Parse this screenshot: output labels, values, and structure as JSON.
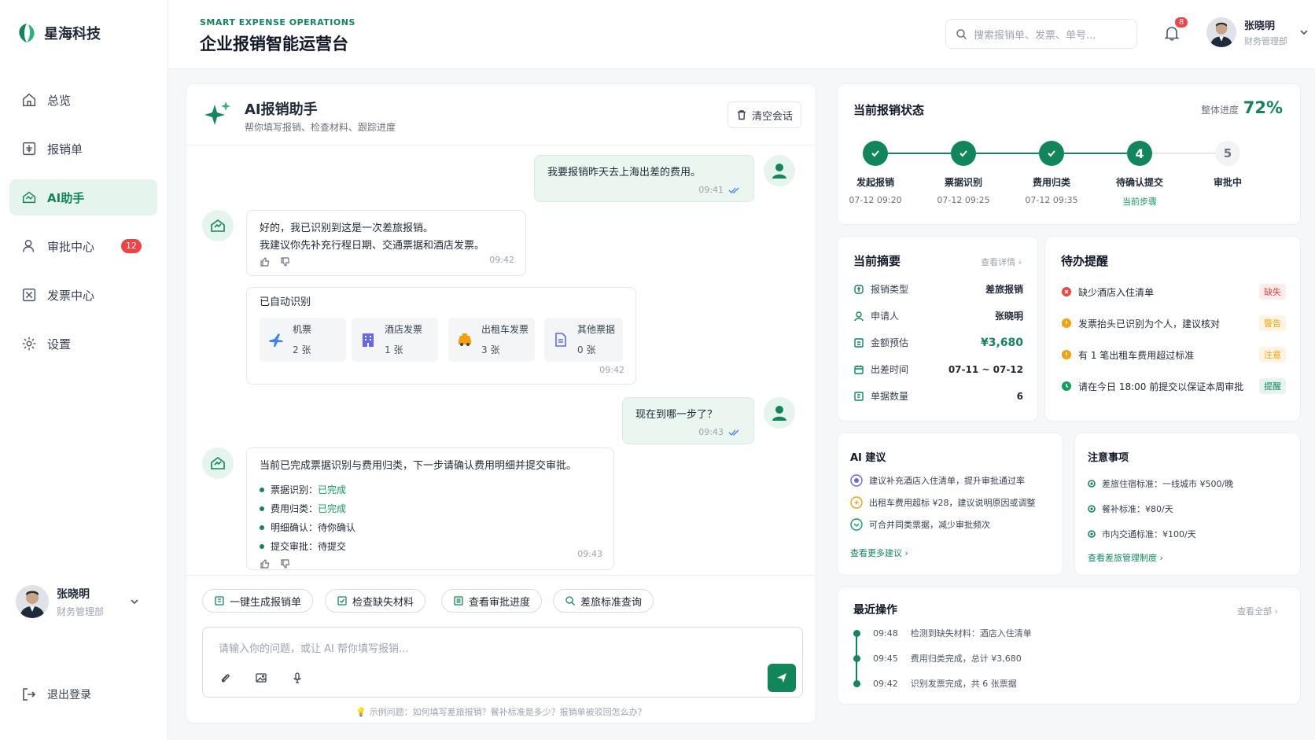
{
  "brand": {
    "name": "星海科技"
  },
  "nav": {
    "items": [
      {
        "label": "总览"
      },
      {
        "label": "报销单"
      },
      {
        "label": "AI助手"
      },
      {
        "label": "审批中心",
        "badge": "12"
      },
      {
        "label": "发票中心"
      },
      {
        "label": "设置"
      }
    ]
  },
  "user": {
    "name": "张晓明",
    "role": "财务管理部"
  },
  "logout": "退出登录",
  "header": {
    "subtitle": "SMART EXPENSE OPERATIONS",
    "title": "企业报销智能运营台",
    "search_placeholder": "搜索报销单、发票、单号...",
    "notification_count": "8"
  },
  "chat": {
    "title": "AI报销助手",
    "subtitle": "帮你填写报销、检查材料、跟踪进度",
    "clear_label": "清空会话",
    "msg1": {
      "text": "我要报销昨天去上海出差的费用。",
      "time": "09:41"
    },
    "msg2": {
      "line1": "好的，我已识别到这是一次差旅报销。",
      "line2": "我建议你先补充行程日期、交通票据和酒店发票。",
      "time": "09:42"
    },
    "recognized": {
      "title": "已自动识别",
      "items": [
        {
          "name": "机票",
          "count": "2 张"
        },
        {
          "name": "酒店发票",
          "count": "1 张"
        },
        {
          "name": "出租车发票",
          "count": "3 张"
        },
        {
          "name": "其他票据",
          "count": "0 张"
        }
      ],
      "time": "09:42"
    },
    "msg3": {
      "text": "现在到哪一步了？",
      "time": "09:43"
    },
    "msg4": {
      "text": "当前已完成票据识别与费用归类，下一步请确认费用明细并提交审批。",
      "items": [
        {
          "k": "票据识别：",
          "v": "已完成"
        },
        {
          "k": "费用归类：",
          "v": "已完成"
        },
        {
          "k": "明细确认：",
          "v": "待你确认"
        },
        {
          "k": "提交审批：",
          "v": "待提交"
        }
      ],
      "time": "09:43"
    },
    "quick_actions": [
      "一键生成报销单",
      "检查缺失材料",
      "查看审批进度",
      "差旅标准查询"
    ],
    "input_placeholder": "请输入你的问题，或让 AI 帮你填写报销...",
    "hint": "示例问题：如何填写差旅报销？餐补标准是多少？报销单被驳回怎么办？"
  },
  "status": {
    "title": "当前报销状态",
    "progress_label": "整体进度",
    "progress_value": "72%",
    "steps": [
      {
        "label": "发起报销",
        "time": "07-12 09:20"
      },
      {
        "label": "票据识别",
        "time": "07-12 09:25"
      },
      {
        "label": "费用归类",
        "time": "07-12 09:35"
      },
      {
        "label": "待确认提交",
        "time": "当前步骤",
        "num": "4"
      },
      {
        "label": "审批中",
        "num": "5"
      }
    ]
  },
  "summary": {
    "title": "当前摘要",
    "link": "查看详情",
    "rows": [
      {
        "k": "报销类型",
        "v": "差旅报销"
      },
      {
        "k": "申请人",
        "v": "张晓明"
      },
      {
        "k": "金额预估",
        "v": "¥3,680"
      },
      {
        "k": "出差时间",
        "v": "07-11 ~ 07-12"
      },
      {
        "k": "单据数量",
        "v": "6"
      }
    ]
  },
  "todo": {
    "title": "待办提醒",
    "rows": [
      {
        "text": "缺少酒店入住清单",
        "tag": "缺失",
        "color": "#ef4444"
      },
      {
        "text": "发票抬头已识别为个人，建议核对",
        "tag": "警告",
        "color": "#f59e0b"
      },
      {
        "text": "有 1 笔出租车费用超过标准",
        "tag": "注意",
        "color": "#f59e0b"
      },
      {
        "text": "请在今日 18:00 前提交以保证本周审批",
        "tag": "提醒",
        "color": "#11a05a"
      }
    ]
  },
  "ai_tips": {
    "title": "AI 建议",
    "rows": [
      "建议补充酒店入住清单，提升审批通过率",
      "出租车费用超标 ¥28，建议说明原因或调整",
      "可合并同类票据，减少审批频次"
    ],
    "link": "查看更多建议"
  },
  "notes": {
    "title": "注意事项",
    "rows": [
      "差旅住宿标准：一线城市 ¥500/晚",
      "餐补标准：¥80/天",
      "市内交通标准：¥100/天"
    ],
    "link": "查看差旅管理制度"
  },
  "recent": {
    "title": "最近操作",
    "link": "查看全部",
    "rows": [
      {
        "time": "09:48",
        "text": "检测到缺失材料：酒店入住清单"
      },
      {
        "time": "09:45",
        "text": "费用归类完成，总计 ¥3,680"
      },
      {
        "time": "09:42",
        "text": "识别发票完成，共 6 张票据"
      }
    ]
  },
  "colors": {
    "accent": "#11865a",
    "danger": "#ef4444",
    "warning": "#f59e0b"
  }
}
